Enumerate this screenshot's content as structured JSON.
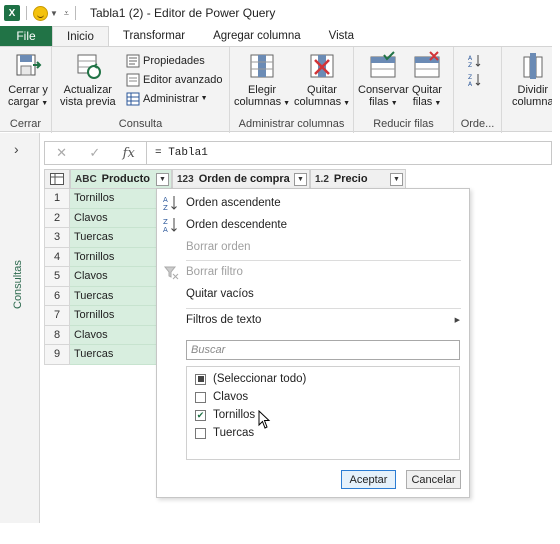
{
  "window": {
    "title": "Tabla1 (2) - Editor de Power Query"
  },
  "tabs": [
    {
      "label": "File"
    },
    {
      "label": "Inicio"
    },
    {
      "label": "Transformar"
    },
    {
      "label": "Agregar columna"
    },
    {
      "label": "Vista"
    }
  ],
  "ribbon": {
    "cerrar": {
      "button": "Cerrar y cargar",
      "line1": "Cerrar y",
      "line2": "cargar",
      "group": "Cerrar"
    },
    "consulta": {
      "actualizar_line1": "Actualizar",
      "actualizar_line2": "vista previa",
      "propiedades": "Propiedades",
      "editor_avanzado": "Editor avanzado",
      "administrar": "Administrar",
      "group": "Consulta"
    },
    "columnas": {
      "elegir_line1": "Elegir",
      "elegir_line2": "columnas",
      "quitar_line1": "Quitar",
      "quitar_line2": "columnas",
      "group": "Administrar columnas"
    },
    "filas": {
      "conservar_line1": "Conservar",
      "conservar_line2": "filas",
      "quitar_line1": "Quitar",
      "quitar_line2": "filas",
      "group": "Reducir filas"
    },
    "ordenar": {
      "group": "Orde..."
    },
    "dividir": {
      "line1": "Dividir",
      "line2": "columna"
    }
  },
  "left_pane": {
    "label": "Consultas"
  },
  "formula_bar": {
    "formula": "= Tabla1"
  },
  "grid": {
    "columns": [
      {
        "type": "ABC",
        "name": "Producto"
      },
      {
        "type": "123",
        "name": "Orden de compra"
      },
      {
        "type": "1.2",
        "name": "Precio"
      }
    ],
    "rows": [
      {
        "n": "1",
        "producto": "Tornillos"
      },
      {
        "n": "2",
        "producto": "Clavos"
      },
      {
        "n": "3",
        "producto": "Tuercas"
      },
      {
        "n": "4",
        "producto": "Tornillos"
      },
      {
        "n": "5",
        "producto": "Clavos"
      },
      {
        "n": "6",
        "producto": "Tuercas"
      },
      {
        "n": "7",
        "producto": "Tornillos"
      },
      {
        "n": "8",
        "producto": "Clavos"
      },
      {
        "n": "9",
        "producto": "Tuercas"
      }
    ]
  },
  "filter_menu": {
    "orden_ascendente": "Orden ascendente",
    "orden_descendente": "Orden descendente",
    "borrar_orden": "Borrar orden",
    "borrar_filtro": "Borrar filtro",
    "quitar_vacios": "Quitar vacíos",
    "filtros_texto": "Filtros de texto",
    "search_placeholder": "Buscar",
    "items": [
      {
        "label": "(Seleccionar todo)",
        "state": "partial"
      },
      {
        "label": "Clavos",
        "state": "unchecked"
      },
      {
        "label": "Tornillos",
        "state": "checked"
      },
      {
        "label": "Tuercas",
        "state": "unchecked"
      }
    ],
    "aceptar": "Aceptar",
    "cancelar": "Cancelar"
  },
  "colors": {
    "accent": "#217346",
    "selected_column": "#d8eedf"
  }
}
